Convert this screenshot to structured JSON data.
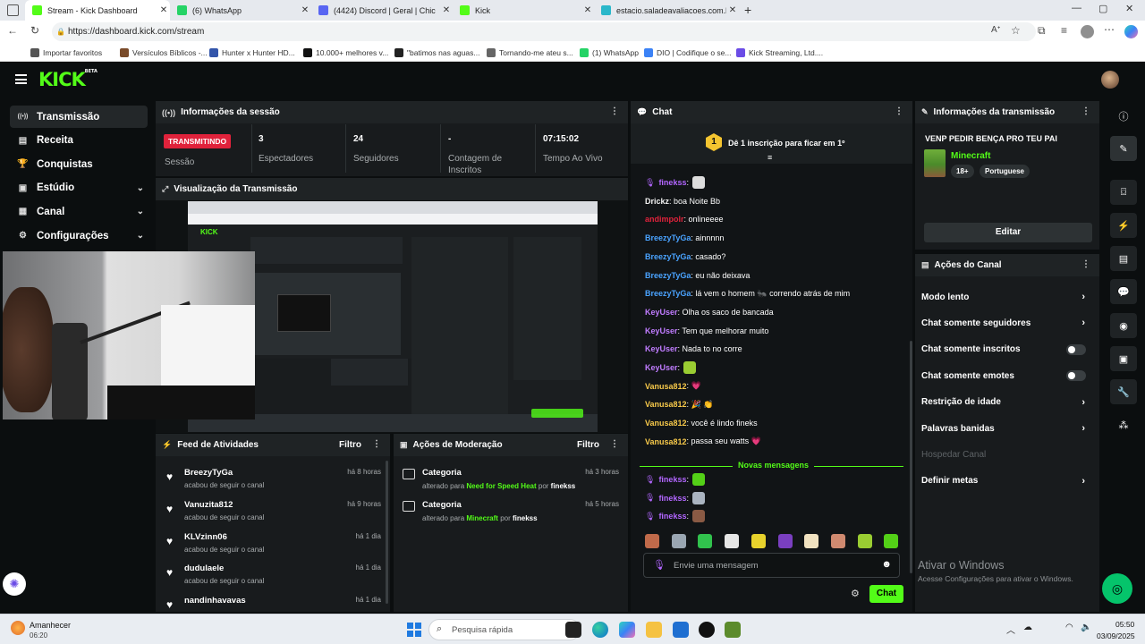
{
  "browser": {
    "tabs": [
      {
        "label": "Stream - Kick Dashboard",
        "color": "#53fc18",
        "active": true
      },
      {
        "label": "(6) WhatsApp",
        "color": "#25d366",
        "active": false
      },
      {
        "label": "(4424) Discord | Geral | Chic",
        "color": "#5865f2",
        "active": false
      },
      {
        "label": "Kick",
        "color": "#53fc18",
        "active": false
      },
      {
        "label": "estacio.saladeavaliacoes.com.br/a",
        "color": "#2ab7ca",
        "active": false
      }
    ],
    "url": "https://dashboard.kick.com/stream",
    "bookmarks": [
      {
        "label": "Importar favoritos",
        "color": "#555"
      },
      {
        "label": "Versículos Bíblicos -...",
        "color": "#7a4b2a"
      },
      {
        "label": "Hunter x Hunter HD...",
        "color": "#3355aa"
      },
      {
        "label": "10.000+ melhores v...",
        "color": "#111"
      },
      {
        "label": "\"batimos nas aguas...",
        "color": "#222"
      },
      {
        "label": "Tornando-me ateu s...",
        "color": "#666"
      },
      {
        "label": "(1) WhatsApp",
        "color": "#25d366"
      },
      {
        "label": "DIO | Codifique o se...",
        "color": "#3b82f6"
      },
      {
        "label": "Kick Streaming, Ltd....",
        "color": "#6b4ce6"
      }
    ]
  },
  "kick": {
    "logo": "KICK",
    "logo_beta": "BETA",
    "accent": "#53fc18",
    "nav": [
      {
        "label": "Transmissão",
        "icon": "broadcast-icon",
        "active": true,
        "expand": false
      },
      {
        "label": "Receita",
        "icon": "receipt-icon",
        "active": false,
        "expand": false
      },
      {
        "label": "Conquistas",
        "icon": "trophy-icon",
        "active": false,
        "expand": false
      },
      {
        "label": "Estúdio",
        "icon": "studio-icon",
        "active": false,
        "expand": true
      },
      {
        "label": "Canal",
        "icon": "channel-icon",
        "active": false,
        "expand": true
      },
      {
        "label": "Configurações",
        "icon": "settings-icon",
        "active": false,
        "expand": true
      }
    ],
    "session": {
      "title": "Informações da sessão",
      "status": "TRANSMITINDO",
      "status_label": "Sessão",
      "stats": [
        {
          "value": "3",
          "label": "Espectadores"
        },
        {
          "value": "24",
          "label": "Seguidores"
        },
        {
          "value": "-",
          "label": "Contagem de Inscritos"
        },
        {
          "value": "07:15:02",
          "label": "Tempo Ao Vivo"
        }
      ]
    },
    "preview_title": "Visualização da Transmissão",
    "feed": {
      "title": "Feed de Atividades",
      "filter": "Filtro",
      "items": [
        {
          "name": "BreezyTyGa",
          "sub": "acabou de seguir o canal",
          "time": "há 8 horas"
        },
        {
          "name": "Vanuzita812",
          "sub": "acabou de seguir o canal",
          "time": "há 9 horas"
        },
        {
          "name": "KLVzinn06",
          "sub": "acabou de seguir o canal",
          "time": "há 1 dia"
        },
        {
          "name": "dudulaele",
          "sub": "acabou de seguir o canal",
          "time": "há 1 dia"
        },
        {
          "name": "nandinhavavas",
          "sub": "",
          "time": "há 1 dia"
        }
      ]
    },
    "moderation": {
      "title": "Ações de Moderação",
      "filter": "Filtro",
      "items": [
        {
          "title": "Categoria",
          "prefix": "alterado para",
          "category": "Need for Speed Heat",
          "by": "por",
          "user": "finekss",
          "time": "há 3 horas"
        },
        {
          "title": "Categoria",
          "prefix": "alterado para",
          "category": "Minecraft",
          "by": "por",
          "user": "finekss",
          "time": "há 5 horas"
        }
      ]
    },
    "chat": {
      "title": "Chat",
      "sub_goal": "Dê 1 inscrição para ficar em 1º",
      "sub_goal_rank": "1",
      "messages": [
        {
          "user": "finekss",
          "color": "#b266ff",
          "text": ":",
          "emote": "#dddddd",
          "mic": true
        },
        {
          "user": "Drickz",
          "color": "#f2f2f2",
          "text": ": boa Noite Bb"
        },
        {
          "user": "andimpolr",
          "color": "#e0223b",
          "text": ": onlineeee"
        },
        {
          "user": "BreezyTyGa",
          "color": "#4aa3ff",
          "text": ": ainnnnn"
        },
        {
          "user": "BreezyTyGa",
          "color": "#4aa3ff",
          "text": ": casado?"
        },
        {
          "user": "BreezyTyGa",
          "color": "#4aa3ff",
          "text": ": eu não deixava"
        },
        {
          "user": "BreezyTyGa",
          "color": "#4aa3ff",
          "text": ": lá vem o homem 🐜 correndo atrás de mim"
        },
        {
          "user": "KeyUser",
          "color": "#c07cff",
          "text": ": Olha os saco de bancada"
        },
        {
          "user": "KeyUser",
          "color": "#c07cff",
          "text": ": Tem que melhorar muito"
        },
        {
          "user": "KeyUser",
          "color": "#c07cff",
          "text": ": Nada to no corre"
        },
        {
          "user": "KeyUser",
          "color": "#c07cff",
          "text": ":",
          "emote": "#9acd32"
        },
        {
          "user": "Vanusa812",
          "color": "#f7c94a",
          "text": ": 💗"
        },
        {
          "user": "Vanusa812",
          "color": "#f7c94a",
          "text": ": 🎉 👏"
        },
        {
          "user": "Vanusa812",
          "color": "#f7c94a",
          "text": ": você é lindo fineks"
        },
        {
          "user": "Vanusa812",
          "color": "#f7c94a",
          "text": ": passa seu watts 💗"
        }
      ],
      "new_messages": "Novas mensagens",
      "new_msgs": [
        {
          "user": "finekss",
          "color": "#b266ff",
          "text": ":",
          "emote": "#53d017",
          "mic": true
        },
        {
          "user": "finekss",
          "color": "#b266ff",
          "text": ":",
          "emote": "#aab4c0",
          "mic": true
        },
        {
          "user": "finekss",
          "color": "#b266ff",
          "text": ":",
          "emote": "#8a5a44",
          "mic": true
        }
      ],
      "emote_bar": [
        "#c06a4a",
        "#9aa6b2",
        "#31c24d",
        "#e6e6e6",
        "#e8d22c",
        "#7a3fc0",
        "#f1e2c0",
        "#d08a70",
        "#9acd32",
        "#53d017"
      ],
      "input_placeholder": "Envie uma mensagem",
      "send_label": "Chat"
    },
    "stream_info": {
      "title": "Informações da transmissão",
      "stream_title": "VENP PEDIR BENÇA PRO TEU PAI",
      "category": "Minecraft",
      "tags": [
        "18+",
        "Portuguese"
      ],
      "edit_label": "Editar"
    },
    "channel_actions": {
      "title": "Ações do Canal",
      "items": [
        {
          "label": "Modo lento",
          "type": "arrow",
          "disabled": false
        },
        {
          "label": "Chat somente seguidores",
          "type": "arrow",
          "disabled": false
        },
        {
          "label": "Chat somente inscritos",
          "type": "toggle",
          "disabled": false
        },
        {
          "label": "Chat somente emotes",
          "type": "toggle",
          "disabled": false
        },
        {
          "label": "Restrição de idade",
          "type": "arrow",
          "disabled": false
        },
        {
          "label": "Palavras banidas",
          "type": "arrow",
          "disabled": false
        },
        {
          "label": "Hospedar Canal",
          "type": "none",
          "disabled": true
        },
        {
          "label": "Definir metas",
          "type": "arrow",
          "disabled": false
        }
      ]
    },
    "windows_watermark": {
      "title": "Ativar o Windows",
      "sub": "Acesse Configurações para ativar o Windows."
    }
  },
  "taskbar": {
    "weather_label": "Amanhecer",
    "weather_time": "06:20",
    "search_placeholder": "Pesquisa rápida",
    "clock_time": "05:50",
    "clock_date": "03/09/2025"
  }
}
